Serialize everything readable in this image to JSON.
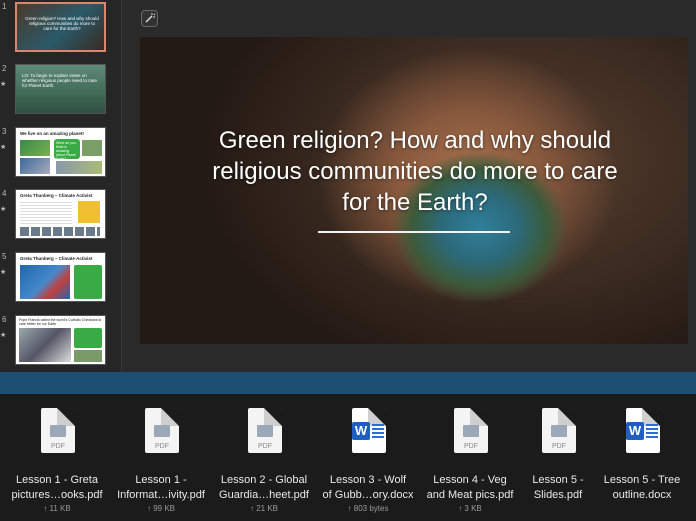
{
  "slides": [
    {
      "number": "1",
      "title": "Green religion? How and why should religious communities do more to care for the Earth?",
      "starred": false
    },
    {
      "number": "2",
      "title": "LO: To begin to explain views on whether religious people need to care for Planet Earth.",
      "starred": true
    },
    {
      "number": "3",
      "title": "We live on an amazing planet!",
      "callout": "What do you think is amazing about Planet Earth?",
      "starred": true
    },
    {
      "number": "4",
      "title": "Greta Thunberg – Climate Activist",
      "starred": true
    },
    {
      "number": "5",
      "title": "Greta Thunberg – Climate Activist",
      "starred": true
    },
    {
      "number": "6",
      "title": "Pope Francis called the world's Catholic Christians to care better for our Earth",
      "starred": true
    }
  ],
  "star_glyph": "★",
  "main_slide": {
    "title": "Green religion? How and why should religious communities do more to care for the Earth?"
  },
  "attachments": [
    {
      "type": "pdf",
      "name": "Lesson 1 - Greta pictures…ooks.pdf",
      "line1": "Lesson 1 - Greta",
      "line2": "pictures…ooks.pdf",
      "size": "↑ 11 KB"
    },
    {
      "type": "pdf",
      "name": "Lesson 1 - Informat…ivity.pdf",
      "line1": "Lesson 1 -",
      "line2": "Informat…ivity.pdf",
      "size": "↑ 99 KB"
    },
    {
      "type": "pdf",
      "name": "Lesson 2 - Global Guardia…heet.pdf",
      "line1": "Lesson 2 - Global",
      "line2": "Guardia…heet.pdf",
      "size": "↑ 21 KB"
    },
    {
      "type": "docx",
      "name": "Lesson 3 - Wolf of Gubb…ory.docx",
      "line1": "Lesson 3 - Wolf",
      "line2": "of Gubb…ory.docx",
      "size": "↑ 803 bytes"
    },
    {
      "type": "pdf",
      "name": "Lesson 4 - Veg and Meat pics.pdf",
      "line1": "Lesson 4 - Veg",
      "line2": "and Meat pics.pdf",
      "size": "↑ 3 KB"
    },
    {
      "type": "pdf",
      "name": "Lesson 5 - Slides.pdf",
      "line1": "Lesson 5 -",
      "line2": "Slides.pdf",
      "size": ""
    },
    {
      "type": "docx",
      "name": "Lesson 5 - Tree outline.docx",
      "line1": "Lesson 5 - Tree",
      "line2": "outline.docx",
      "size": ""
    }
  ],
  "pdf_tag": "PDF",
  "word_badge": "W",
  "colors": {
    "selection": "#d9866a",
    "divider": "#1c4f72",
    "word_blue": "#1f5fbf",
    "slide2_bg": "#4a7a6a",
    "callout_green": "#3aaa44",
    "greta_accent": "#2266aa"
  }
}
